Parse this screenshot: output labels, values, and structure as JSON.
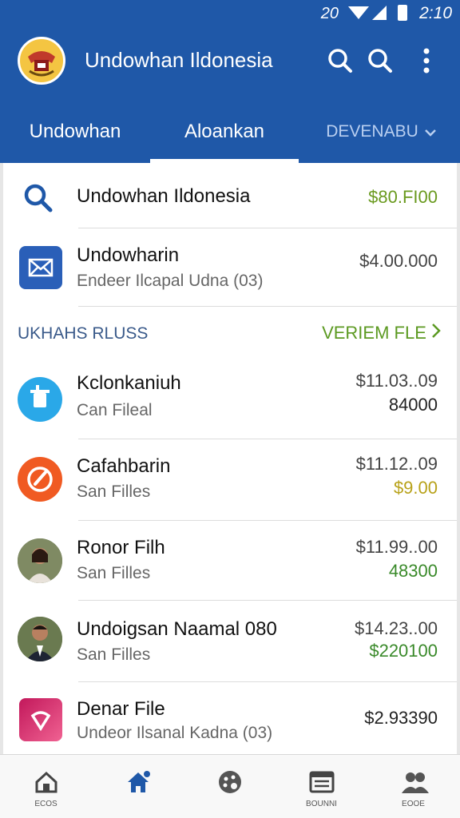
{
  "status_bar": {
    "left_text": "20",
    "time": "2:10"
  },
  "app_bar": {
    "title": "Undowhan Ildonesia"
  },
  "tabs": [
    {
      "label": "Undowhan"
    },
    {
      "label": "Aloankan"
    },
    {
      "label": "DEVENABU"
    }
  ],
  "top_items": [
    {
      "title": "Undowhan Ildonesia",
      "amount": "$80.FI00",
      "amount_color": "#6a9a1f",
      "icon": "search-icon"
    },
    {
      "title": "Undowharin",
      "subtitle": "Endeer Ilcapal Udna (03)",
      "amount": "$4.00.000",
      "amount_color": "#444444",
      "icon": "mail-icon"
    }
  ],
  "section": {
    "label": "UKHAHS RLUSS",
    "link": "VERIEM FLE"
  },
  "items": [
    {
      "title": "Kclonkaniuh",
      "subtitle": "Can Fileal",
      "amount1": "$11.03..09",
      "amount2": "84000",
      "amount2_color": "#222222",
      "icon": "cup-icon"
    },
    {
      "title": "Cafahbarin",
      "subtitle": "San Filles",
      "amount1": "$11.12..09",
      "amount2": "$9.00",
      "amount2_color": "#b8a21a",
      "icon": "pen-icon"
    },
    {
      "title": "Ronor Filh",
      "subtitle": "San Filles",
      "amount1": "$11.99..00",
      "amount2": "48300",
      "amount2_color": "#3a8a2a",
      "icon": "woman-avatar"
    },
    {
      "title": "Undoigsan Naamal 080",
      "subtitle": "San Filles",
      "amount1": "$14.23..00",
      "amount2": "$220100",
      "amount2_color": "#3a8a2a",
      "icon": "man-avatar"
    },
    {
      "title": "Denar File",
      "subtitle": "Undeor Ilsanal Kadna (03)",
      "amount1": "$2.93390",
      "amount2": "",
      "amount2_color": "#222222",
      "icon": "app-icon"
    }
  ],
  "bottom_nav": [
    {
      "label": "ECOS",
      "icon": "house-icon"
    },
    {
      "label": "",
      "icon": "home-active-icon"
    },
    {
      "label": "",
      "icon": "palette-icon"
    },
    {
      "label": "BOUNNI",
      "icon": "list-icon"
    },
    {
      "label": "EOOE",
      "icon": "people-icon"
    }
  ],
  "colors": {
    "primary": "#1f58a8",
    "accent_green": "#5c9a22"
  }
}
